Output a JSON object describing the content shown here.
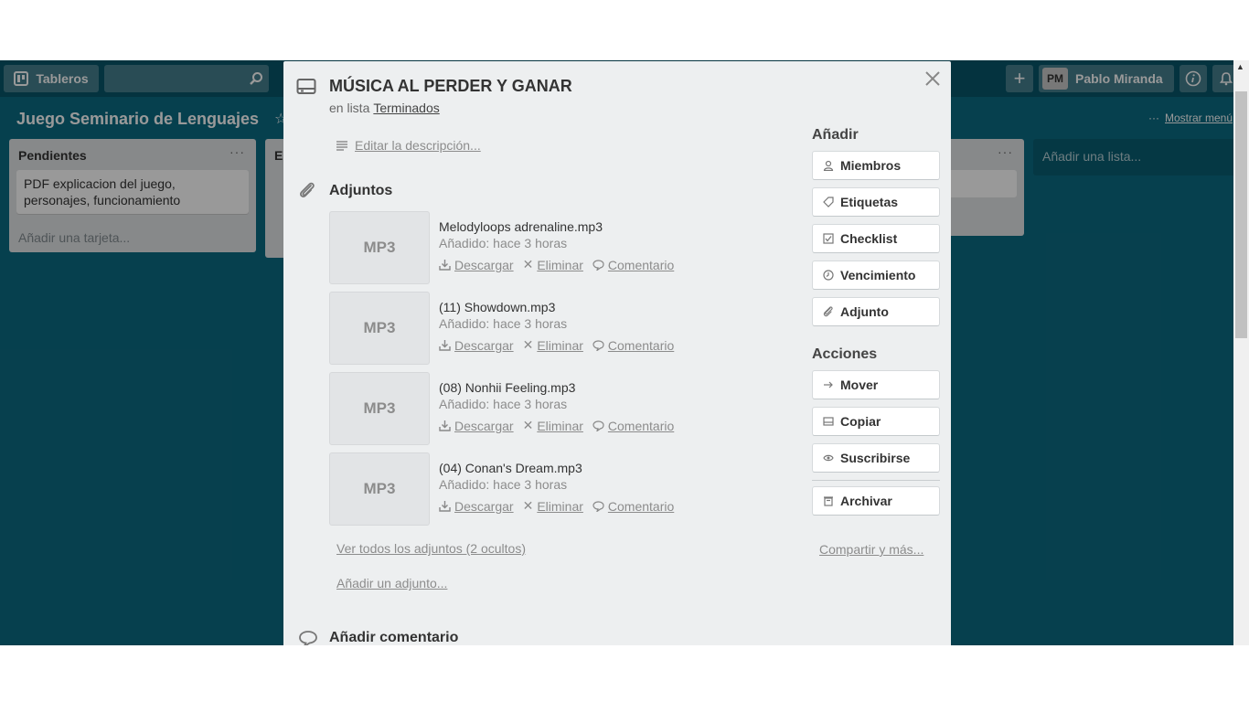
{
  "header": {
    "boards_label": "Tableros",
    "user_initials": "PM",
    "user_name": "Pablo Miranda"
  },
  "board": {
    "title": "Juego Seminario de Lenguajes",
    "show_menu": "Mostrar menú",
    "lists": [
      {
        "title": "Pendientes",
        "cards": [
          "PDF explicacion del juego, personajes, funcionamiento"
        ],
        "add_card": "Añadir una tarjeta..."
      }
    ],
    "list2_initial": "E",
    "add_list": "Añadir una lista..."
  },
  "card": {
    "title": "MÚSICA AL PERDER Y GANAR",
    "in_list_prefix": "en lista",
    "list_name": "Terminados",
    "edit_description": "Editar la descripción...",
    "attachments_heading": "Adjuntos",
    "attachments": [
      {
        "thumb": "MP3",
        "name": "Melodyloops adrenaline.mp3",
        "added": "Añadido: hace 3 horas"
      },
      {
        "thumb": "MP3",
        "name": "(11) Showdown.mp3",
        "added": "Añadido: hace 3 horas"
      },
      {
        "thumb": "MP3",
        "name": "(08) Nonhii Feeling.mp3",
        "added": "Añadido: hace 3 horas"
      },
      {
        "thumb": "MP3",
        "name": "(04) Conan's Dream.mp3",
        "added": "Añadido: hace 3 horas"
      }
    ],
    "actions": {
      "download": "Descargar",
      "delete": "Eliminar",
      "comment": "Comentario"
    },
    "view_all": "Ver todos los adjuntos (2 ocultos)",
    "add_attachment": "Añadir un adjunto...",
    "add_comment_heading": "Añadir comentario"
  },
  "sidebar": {
    "add_heading": "Añadir",
    "add_buttons": [
      "Miembros",
      "Etiquetas",
      "Checklist",
      "Vencimiento",
      "Adjunto"
    ],
    "actions_heading": "Acciones",
    "action_buttons": [
      "Mover",
      "Copiar",
      "Suscribirse"
    ],
    "archive": "Archivar",
    "share_more": "Compartir y más..."
  },
  "colors": {
    "board_bg": "#0b6b82",
    "header_bg": "#075569",
    "modal_bg": "#edeff0"
  }
}
